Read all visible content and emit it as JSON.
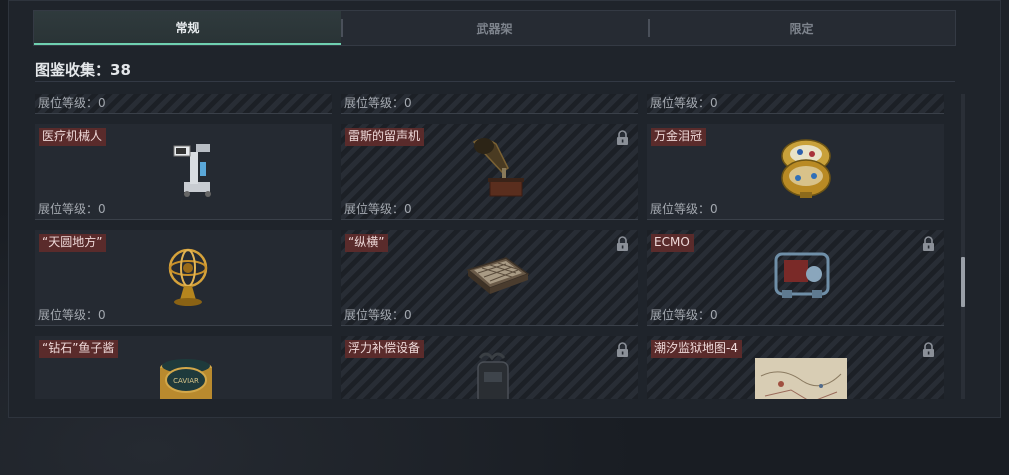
{
  "tabs": [
    {
      "label": "常规",
      "active": true
    },
    {
      "label": "武器架",
      "active": false
    },
    {
      "label": "限定",
      "active": false
    }
  ],
  "collection": {
    "label": "图鉴收集：",
    "count": "38"
  },
  "level_label": "展位等级：",
  "top_row": [
    {
      "level": "0"
    },
    {
      "level": "0"
    },
    {
      "level": "0"
    }
  ],
  "items": [
    {
      "name": "医疗机械人",
      "level": "0",
      "locked": false,
      "icon": "medical-robot-icon"
    },
    {
      "name": "雷斯的留声机",
      "level": "0",
      "locked": true,
      "icon": "gramophone-icon"
    },
    {
      "name": "万金泪冠",
      "level": "0",
      "locked": false,
      "icon": "jeweled-egg-icon"
    },
    {
      "name": "“天圆地方”",
      "level": "0",
      "locked": false,
      "icon": "armillary-sphere-icon"
    },
    {
      "name": "“纵横”",
      "level": "0",
      "locked": true,
      "icon": "chessboard-icon"
    },
    {
      "name": "ECMO",
      "level": "0",
      "locked": true,
      "icon": "ecmo-machine-icon"
    },
    {
      "name": "“钻石”鱼子酱",
      "level": "",
      "locked": false,
      "icon": "caviar-tin-icon"
    },
    {
      "name": "浮力补偿设备",
      "level": "",
      "locked": true,
      "icon": "buoyancy-device-icon"
    },
    {
      "name": "潮汐监狱地图-4",
      "level": "",
      "locked": true,
      "icon": "prison-map-icon"
    }
  ],
  "caviar_text": "CAVIAR",
  "colors": {
    "accent": "#6fd0b0",
    "badge": "#5a2b2b",
    "panel": "#1f242b"
  }
}
